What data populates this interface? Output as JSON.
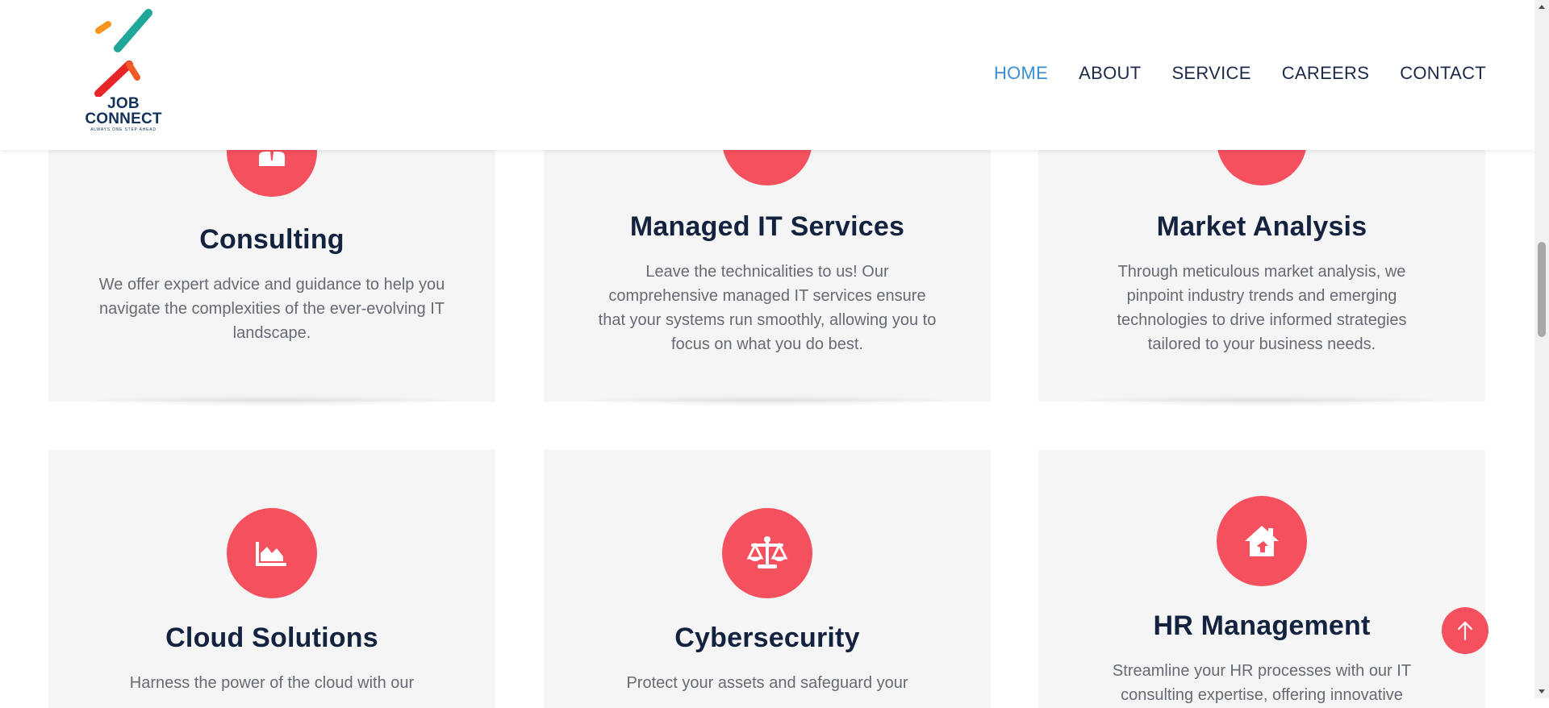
{
  "brand": {
    "name_line1": "JOB",
    "name_line2": "CONNECT",
    "tagline": "ALWAYS ONE STEP AHEAD"
  },
  "nav": {
    "items": [
      {
        "label": "HOME",
        "active": true
      },
      {
        "label": "ABOUT"
      },
      {
        "label": "SERVICE"
      },
      {
        "label": "CAREERS"
      },
      {
        "label": "CONTACT"
      }
    ]
  },
  "services": [
    {
      "title": "Consulting",
      "icon": "briefcase-person-icon",
      "text": "We offer expert advice and guidance to help you navigate the complexities of the ever-evolving IT landscape."
    },
    {
      "title": "Managed IT Services",
      "icon": "gear-icon",
      "text": "Leave the technicalities to us! Our comprehensive managed IT services ensure that your systems run smoothly, allowing you to focus on what you do best."
    },
    {
      "title": "Market Analysis",
      "icon": "chart-icon",
      "text": "Through meticulous market analysis, we pinpoint industry trends and emerging technologies to drive informed strategies tailored to your business needs."
    },
    {
      "title": "Cloud Solutions",
      "icon": "area-chart-icon",
      "text": "Harness the power of the cloud with our"
    },
    {
      "title": "Cybersecurity",
      "icon": "scale-icon",
      "text": "Protect your assets and safeguard your"
    },
    {
      "title": "HR Management",
      "icon": "house-icon",
      "text": "Streamline your HR processes with our IT consulting expertise, offering innovative"
    }
  ],
  "colors": {
    "accent": "#f4505e",
    "nav_active": "#3a8fd1",
    "heading": "#13223f",
    "card_bg": "#f5f5f5"
  }
}
